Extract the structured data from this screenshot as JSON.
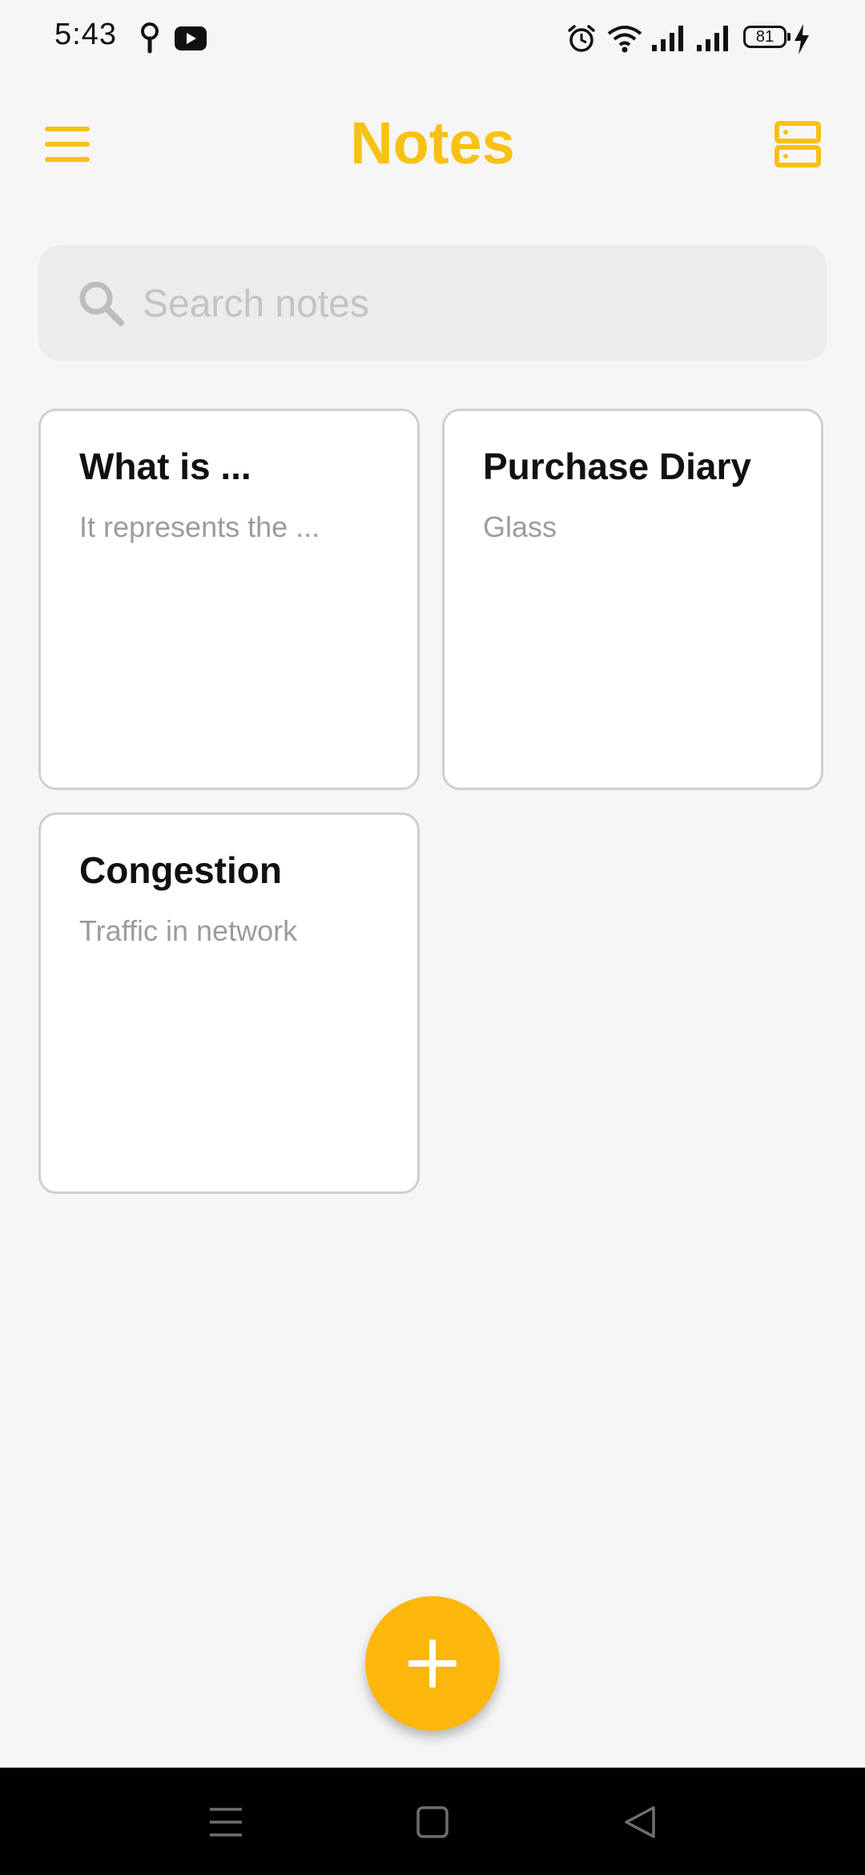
{
  "status_bar": {
    "time": "5:43",
    "battery_level": "81",
    "icons": [
      "location-pin-icon",
      "youtube-icon",
      "alarm-icon",
      "wifi-icon",
      "signal-icon",
      "signal-icon",
      "battery-icon",
      "charging-icon"
    ]
  },
  "app_bar": {
    "title": "Notes",
    "menu_icon": "hamburger-menu-icon",
    "layout_icon": "list-layout-icon"
  },
  "search": {
    "placeholder": "Search notes",
    "value": ""
  },
  "notes": [
    {
      "title": "What is ...",
      "body": "It represents the ..."
    },
    {
      "title": "Purchase Diary",
      "body": "Glass"
    },
    {
      "title": "Congestion",
      "body": "Traffic in network"
    }
  ],
  "fab": {
    "icon": "plus-icon"
  },
  "nav_bar": {
    "icons": [
      "recents-menu-icon",
      "home-square-icon",
      "back-triangle-icon"
    ]
  },
  "colors": {
    "accent": "#f7c114",
    "fab": "#fdb70c",
    "background": "#f6f6f6",
    "search_bg": "#ececec",
    "card_border": "#cfcfcf"
  }
}
